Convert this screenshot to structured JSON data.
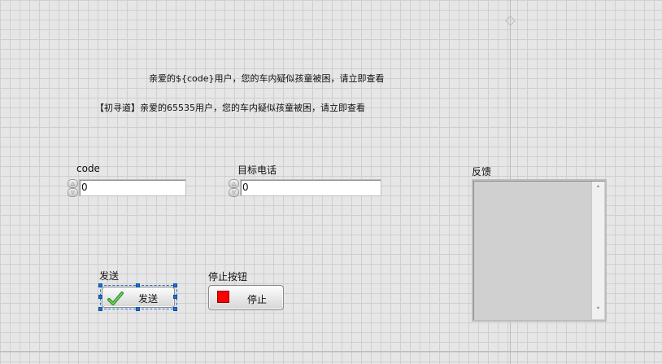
{
  "text_lines": {
    "template": "亲爱的${code}用户，您的车内疑似孩童被困，请立即查看",
    "result": "【初寻道】亲爱的65535用户，您的车内疑似孩童被困，请立即查看"
  },
  "code_control": {
    "label": "code",
    "value": "0",
    "spin_up": "△",
    "spin_down": "▽"
  },
  "phone_control": {
    "label": "目标电话",
    "value": "0",
    "spin_up": "△",
    "spin_down": "▽"
  },
  "send_control": {
    "label": "发送",
    "button_text": "发送"
  },
  "stop_control": {
    "label": "停止按钮",
    "button_text": "停止"
  },
  "feedback_control": {
    "label": "反馈",
    "value": "",
    "scroll_up": "˄",
    "scroll_down": "˅"
  },
  "colors": {
    "canvas": "#e6e6e6",
    "grid": "#cfcfcf",
    "selection": "#1f6fd1",
    "stop_red": "#ff0000",
    "check_green": "#3aa531"
  }
}
